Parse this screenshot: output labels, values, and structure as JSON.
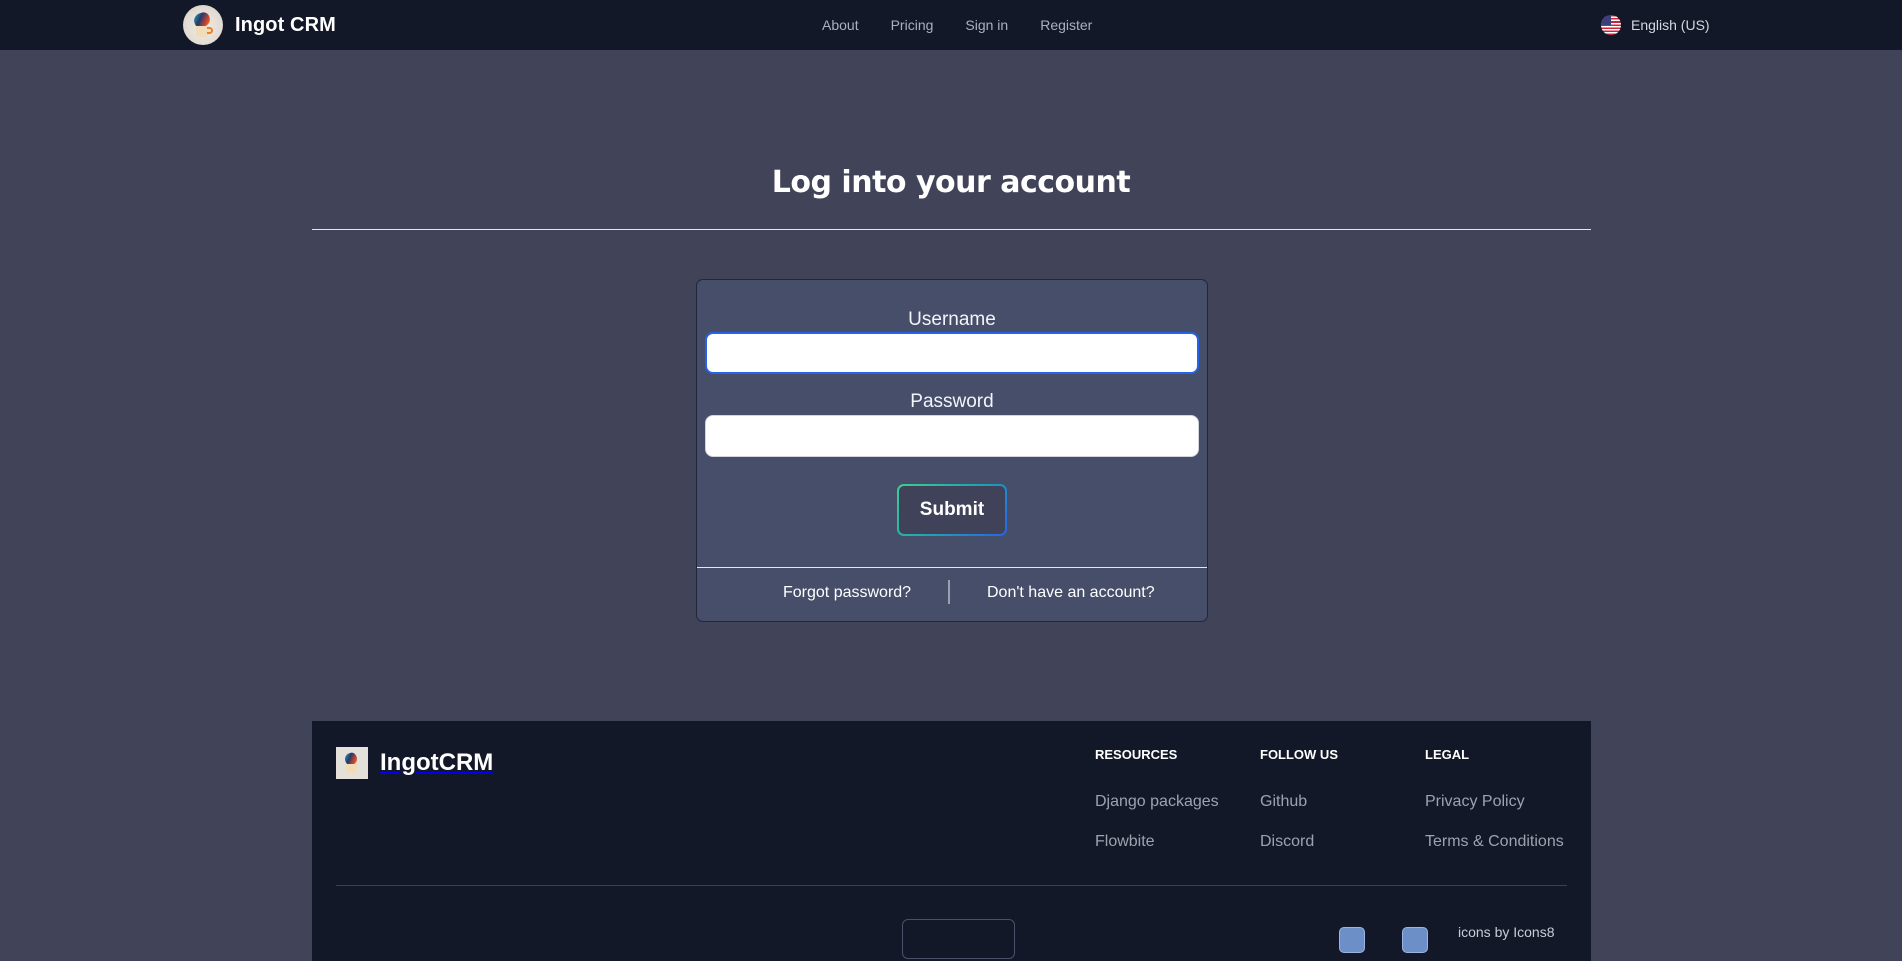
{
  "navbar": {
    "brand": "Ingot CRM",
    "links": [
      "About",
      "Pricing",
      "Sign in",
      "Register"
    ],
    "language": "English (US)"
  },
  "main": {
    "title": "Log into your account",
    "form": {
      "username_label": "Username",
      "username_value": "",
      "password_label": "Password",
      "password_value": "",
      "submit_label": "Submit",
      "forgot_link": "Forgot password?",
      "register_link": "Don't have an account?"
    }
  },
  "footer": {
    "brand": "IngotCRM",
    "columns": [
      {
        "heading": "Resources",
        "links": [
          "Django packages",
          "Flowbite"
        ]
      },
      {
        "heading": "Follow us",
        "links": [
          "Github",
          "Discord"
        ]
      },
      {
        "heading": "Legal",
        "links": [
          "Privacy Policy",
          "Terms & Conditions"
        ]
      }
    ],
    "credit": "icons by Icons8"
  },
  "colors": {
    "page_bg": "#414358",
    "navbar_bg": "#121828",
    "card_bg": "#474e69",
    "focus_ring": "#2563eb",
    "submit_gradient_start": "#3ecf8e",
    "submit_gradient_end": "#2563eb"
  }
}
